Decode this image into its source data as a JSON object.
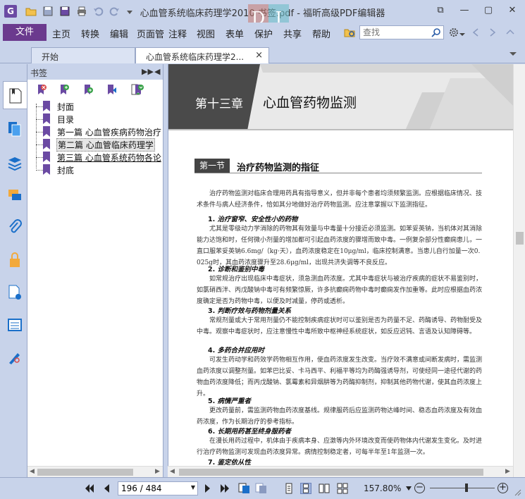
{
  "window": {
    "title": "心血管系统临床药理学2010 书签.pdf - 福昕高级PDF编辑器",
    "watermark_left": "D",
    "watermark_right": "I",
    "minimize": "—",
    "restore": "▢",
    "close": "✕",
    "ribbon_toggle": "⧉"
  },
  "menu": {
    "file": "文件",
    "items": [
      "主页",
      "转换",
      "编辑",
      "页面管",
      "注释",
      "视图",
      "表单",
      "保护",
      "共享",
      "帮助"
    ],
    "search_placeholder": "查找"
  },
  "tabs": [
    {
      "label": "开始"
    },
    {
      "label": "心血管系统临床药理学2...",
      "close": "×"
    }
  ],
  "bookmarks_panel": {
    "title": "书签",
    "collapse": "▶▶",
    "options": "◀",
    "items": [
      {
        "label": "封面"
      },
      {
        "label": "目录"
      },
      {
        "label": "第一篇 心血管疾病药物治疗"
      },
      {
        "label": "第二篇 心血管临床药理学"
      },
      {
        "label": "第三篇 心血管系统药物各论"
      },
      {
        "label": "封底"
      }
    ]
  },
  "document": {
    "chapter_num": "第十三章",
    "chapter_title": "心血管药物监测",
    "section_tag": "第一节",
    "section_title": "治疗药物监测的指征",
    "intro": "治疗药物监测对临床合理用药具有指导意义，但并非每个患者均须频繁监测。应根据临床情况、技术条件与病人经济条件，恰如其分地做好治疗药物监测。应注意掌握以下监测指征。",
    "sections": [
      {
        "num": "1.",
        "title": "治疗窗窄、安全性小的药物",
        "body": "尤其是零级动力学消除的药物其有效量与中毒量十分接近必须监测。如苯妥英钠，当机体对其消除能力达饱和时，任何微小剂量的增加都可引起血药浓度的骤增而致中毒。一例复杂部分性癫痫患儿，一直口服苯妥英钠6.6mg/（kg·天），血药浓度稳定在10μg/ml，临床控制满意。当患儿自行加量一次0.025g时，其血药浓度骤升至28.6μg/ml，出现共济失调等不良反应。"
      },
      {
        "num": "2.",
        "title": "诊断和鉴别中毒",
        "body": "如常规治疗出现临床中毒症状，须急测血药浓度。尤其中毒症状与被治疗疾病的症状不易鉴别时，如氯硝西泮、丙戊酸钠中毒可有频繁惊厥，许多抗癫痫药物中毒时癫痫发作加重等。此时应根据血药浓度确定是否为药物中毒，以便及时减量，停药或透析。"
      },
      {
        "num": "3.",
        "title": "判断疗效与药物剂量关系",
        "body": "常规剂量或大于常用剂量仍不能控制疾病症状时可以鉴别是否为药量不足、药酶诱导、药物耐受及中毒。观察中毒症状时，应注意慢性中毒所致中枢神经系统症状，如反应迟钝、言语及认知障碍等。"
      },
      {
        "num": "4.",
        "title": "多药合并应用时",
        "body": "可发生药动学和药效学药物相互作用，使血药浓度发生改变。当疗效不满意或间断发病时，需监测血药浓度以调整剂量。如苯巴比妥、卡马西平、利福平等均为药酶强诱导剂，可使经同一途径代谢的药物血药浓度降低；而丙戊酸钠、氯霉素和异烟肼等为药酶抑制剂，抑制其他药物代谢，使其血药浓度上升。"
      },
      {
        "num": "5.",
        "title": "病情严重者",
        "body": "更改药量前，需监测药物血药浓度基线。规律服药后应监测药物达峰时间、稳态血药浓度及有效血药浓度，作为长期治疗的参考指标。"
      },
      {
        "num": "6.",
        "title": "长期用药甚至终身服药者",
        "body": "在漫长用药过程中，机体由于疾病本身、应激等内外环境改变而使药物体内代谢发生变化。及时进行治疗药物监测可发现血药浓度异常。病情控制稳定者，可每半年至1年监测一次。"
      },
      {
        "num": "7.",
        "title": "鉴定依从性",
        "body": ""
      }
    ]
  },
  "status": {
    "page_value": "196 / 484",
    "zoom": "157.80%",
    "zoom_out": "−",
    "zoom_in": "+"
  }
}
